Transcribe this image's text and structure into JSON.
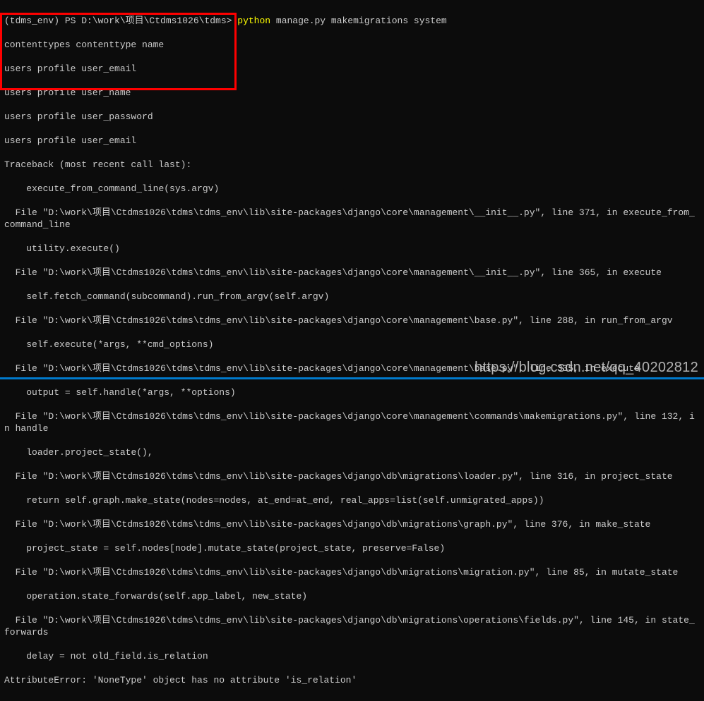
{
  "prompt": {
    "env": "(tdms_env) PS D:\\work\\项目\\Ctdms1026\\tdms>",
    "command_binary": "python",
    "command_args": "manage.py makemigrations system"
  },
  "highlighted_output": [
    "contenttypes contenttype name",
    "users profile user_email",
    "users profile user_name",
    "users profile user_password",
    "users profile user_email",
    "Traceback (most recent call last):"
  ],
  "traceback_lines": [
    "    execute_from_command_line(sys.argv)",
    "  File \"D:\\work\\项目\\Ctdms1026\\tdms\\tdms_env\\lib\\site-packages\\django\\core\\management\\__init__.py\", line 371, in execute_from_command_line",
    "    utility.execute()",
    "  File \"D:\\work\\项目\\Ctdms1026\\tdms\\tdms_env\\lib\\site-packages\\django\\core\\management\\__init__.py\", line 365, in execute",
    "    self.fetch_command(subcommand).run_from_argv(self.argv)",
    "  File \"D:\\work\\项目\\Ctdms1026\\tdms\\tdms_env\\lib\\site-packages\\django\\core\\management\\base.py\", line 288, in run_from_argv",
    "    self.execute(*args, **cmd_options)",
    "  File \"D:\\work\\项目\\Ctdms1026\\tdms\\tdms_env\\lib\\site-packages\\django\\core\\management\\base.py\", line 335, in execute",
    "    output = self.handle(*args, **options)",
    "  File \"D:\\work\\项目\\Ctdms1026\\tdms\\tdms_env\\lib\\site-packages\\django\\core\\management\\commands\\makemigrations.py\", line 132, in handle",
    "    loader.project_state(),",
    "  File \"D:\\work\\项目\\Ctdms1026\\tdms\\tdms_env\\lib\\site-packages\\django\\db\\migrations\\loader.py\", line 316, in project_state",
    "    return self.graph.make_state(nodes=nodes, at_end=at_end, real_apps=list(self.unmigrated_apps))",
    "  File \"D:\\work\\项目\\Ctdms1026\\tdms\\tdms_env\\lib\\site-packages\\django\\db\\migrations\\graph.py\", line 376, in make_state",
    "    project_state = self.nodes[node].mutate_state(project_state, preserve=False)",
    "  File \"D:\\work\\项目\\Ctdms1026\\tdms\\tdms_env\\lib\\site-packages\\django\\db\\migrations\\migration.py\", line 85, in mutate_state",
    "    operation.state_forwards(self.app_label, new_state)",
    "  File \"D:\\work\\项目\\Ctdms1026\\tdms\\tdms_env\\lib\\site-packages\\django\\db\\migrations\\operations\\fields.py\", line 145, in state_forwards",
    "    delay = not old_field.is_relation",
    "AttributeError: 'NoneType' object has no attribute 'is_relation'"
  ],
  "watermark": "https://blog.csdn.net/qq_40202812"
}
